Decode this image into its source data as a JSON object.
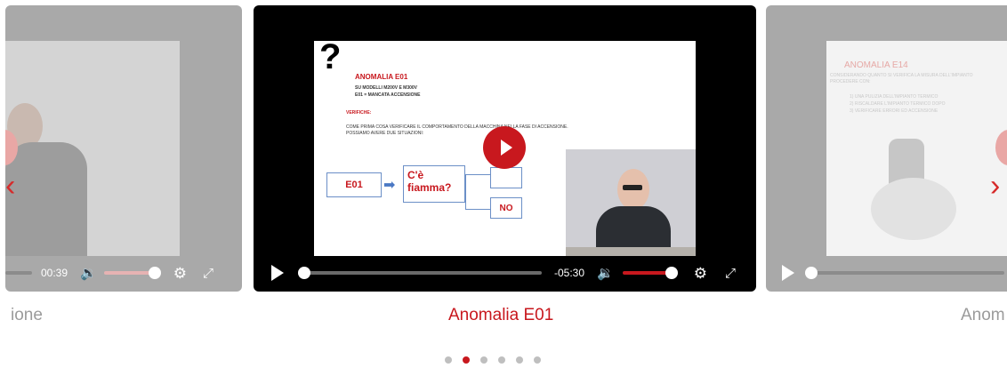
{
  "carousel": {
    "prev_arrow": "‹",
    "next_arrow": "›",
    "left": {
      "caption": "ione",
      "time": "00:39"
    },
    "center": {
      "caption": "Anomalia E01",
      "time": "-05:30",
      "slide": {
        "question_mark": "?",
        "title": "ANOMALIA E01",
        "bullets": [
          "SU MODELLI M200V E M300V",
          "E01 = MANCATA ACCENSIONE"
        ],
        "verifiche": "VERIFICHE:",
        "body_line1": "COME PRIMA COSA VERIFICARE IL COMPORTAMENTO DELLA MACCHINA NELLA FASE DI ACCENSIONE.",
        "body_line2": "POSSIAMO AVERE DUE SITUAZIONI:",
        "box_e01": "E01",
        "box_question": "C'è fiamma?",
        "box_no": "NO"
      },
      "progress": 0
    },
    "right": {
      "caption": "Anom",
      "slide": {
        "title": "ANOMALIA E14",
        "line1": "CONSIDERANDO QUANTO SI VERIFICA LA MISURA DELL'IMPIANTO",
        "line2": "PROCEDERE CON:",
        "items": [
          "1)  UNA PULIZIA DELL'IMPIANTO TERMICO",
          "2)  RISCALDARE L'IMPIANTO TERMICO DOPO",
          "3)  VERIFICARE ERRORI ED ACCENSIONE"
        ]
      }
    },
    "dots_count": 6,
    "active_dot": 1
  },
  "colors": {
    "accent": "#c8181e",
    "caption_active": "#c8181e",
    "caption_inactive": "#9b9b9b"
  },
  "icons": [
    "play-icon",
    "volume-icon",
    "gear-icon",
    "fullscreen-icon",
    "chevron-left-icon",
    "chevron-right-icon"
  ]
}
